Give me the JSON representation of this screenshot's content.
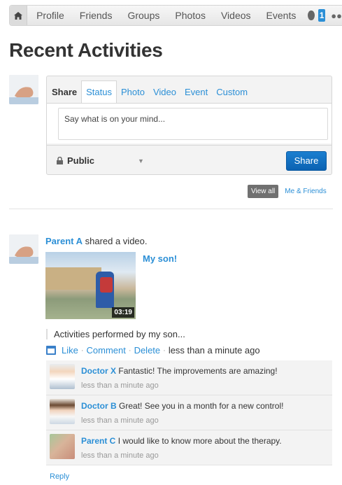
{
  "nav": {
    "items": [
      "Profile",
      "Friends",
      "Groups",
      "Photos",
      "Videos",
      "Events"
    ],
    "notification_count": "1"
  },
  "page_title": "Recent Activities",
  "share": {
    "label": "Share",
    "tabs": [
      "Status",
      "Photo",
      "Video",
      "Event",
      "Custom"
    ],
    "active_tab": "Status",
    "placeholder": "Say what is on your mind...",
    "privacy": "Public",
    "button": "Share"
  },
  "filters": {
    "view_all": "View all",
    "me_friends": "Me & Friends"
  },
  "activity": {
    "actor": "Parent A",
    "action": "shared a video.",
    "video_title": "My son!",
    "video_duration": "03:19",
    "description": "Activities performed by my son...",
    "actions": {
      "like": "Like",
      "comment": "Comment",
      "delete": "Delete",
      "time": "less than a minute ago"
    },
    "comments": [
      {
        "author": "Doctor X",
        "text": "Fantastic! The improvements are amazing!",
        "time": "less than a minute ago"
      },
      {
        "author": "Doctor B",
        "text": "Great! See you in a month for a new control!",
        "time": "less than a minute ago"
      },
      {
        "author": "Parent C",
        "text": "I would like to know more about the therapy.",
        "time": "less than a minute ago"
      }
    ],
    "reply": "Reply"
  }
}
